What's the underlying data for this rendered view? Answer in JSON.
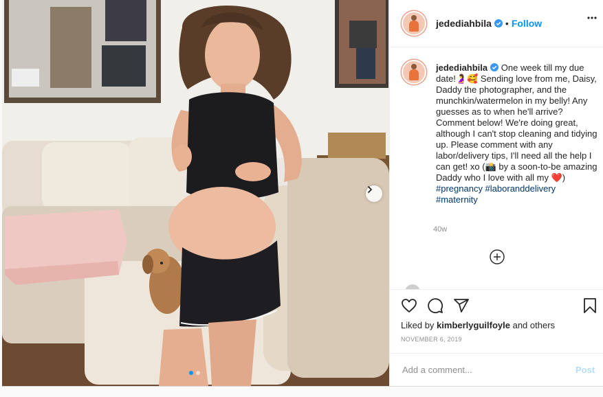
{
  "header": {
    "username": "jedediahbila",
    "separator": "•",
    "follow_label": "Follow"
  },
  "caption": {
    "username": "jedediahbila",
    "text": "One week till my due date!🤰🥰 Sending love from me, Daisy, Daddy the photographer, and the munchkin/watermelon in my belly! Any guesses as to when he'll arrive? Comment below! We're doing great, although I can't stop cleaning and tidying up. Please comment with any labor/delivery tips, I'll need all the help I can get! xo (📸 by a soon-to-be amazing Daddy who I love with all my ❤️)",
    "hashtags": "#pregnancy #laboranddelivery #maternity",
    "age": "40w"
  },
  "likes": {
    "prefix": "Liked by",
    "user": "kimberlyguilfoyle",
    "suffix": "and others"
  },
  "post_date": "NOVEMBER 6, 2019",
  "comment_box": {
    "placeholder": "Add a comment...",
    "post_label": "Post"
  },
  "carousel": {
    "total": 2,
    "current": 1
  },
  "colors": {
    "accent": "#0095f6",
    "post_disabled": "#b2dffc",
    "hashtag": "#00376b",
    "muted": "#8e8e8e"
  },
  "icons": [
    "more-options-icon",
    "verified-badge-icon",
    "heart-icon",
    "comment-icon",
    "share-icon",
    "save-icon",
    "load-more-comments-icon",
    "next-photo-icon"
  ]
}
